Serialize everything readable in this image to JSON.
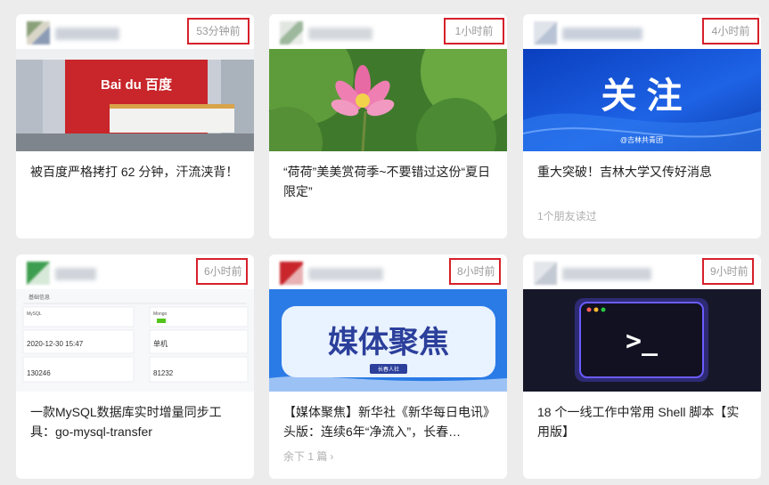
{
  "cards": [
    {
      "time": "53分钟前",
      "title": "被百度严格拷打 62 分钟，汗流浃背！",
      "meta": "",
      "image_text": "Bai du 百度"
    },
    {
      "time": "1小时前",
      "title": "“荷荷”美美赏荷季~不要错过这份“夏日限定”",
      "meta": ""
    },
    {
      "time": "4小时前",
      "title": "重大突破！吉林大学又传好消息",
      "meta": "1个朋友读过",
      "image_text": "关 注",
      "image_caption": "@吉林共青团"
    },
    {
      "time": "6小时前",
      "title": "一款MySQL数据库实时增量同步工具：go-mysql-transfer",
      "meta": "",
      "image_text": {
        "header": "基础信息",
        "cells": [
          "MySQL",
          "Mongo",
          "2020-12-30 15:47",
          "单机",
          "130246",
          "81232"
        ]
      }
    },
    {
      "time": "8小时前",
      "title": "【媒体聚焦】新华社《新华每日电讯》头版：连续6年“净流入”，长春…",
      "meta": "余下 1 篇",
      "image_text": "媒体聚焦",
      "image_caption": "长春人社"
    },
    {
      "time": "9小时前",
      "title": "18 个一线工作中常用 Shell 脚本【实用版】",
      "meta": "",
      "image_text": ">_"
    }
  ],
  "colors": {
    "highlight_border": "#d6202a",
    "time_text": "#9a9a9a",
    "meta_text": "#b0b0b0",
    "title_text": "#222222",
    "page_bg": "#ececec"
  }
}
